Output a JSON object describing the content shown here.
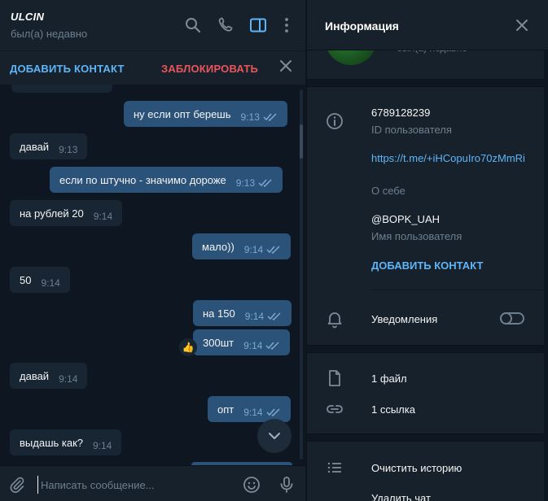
{
  "chat": {
    "name": "ULCIN",
    "status": "был(а) недавно",
    "actions": {
      "add_contact": "ДОБАВИТЬ КОНТАКТ",
      "block": "ЗАБЛОКИРОВАТЬ"
    },
    "messages": [
      {
        "dir": "out",
        "text": "ну если опт берешь",
        "time": "9:13",
        "read": true
      },
      {
        "dir": "in",
        "text": "давай",
        "time": "9:13"
      },
      {
        "dir": "out",
        "text": "если по штучно - значимо дороже",
        "time": "9:13",
        "read": true
      },
      {
        "dir": "in",
        "text": "на рублей 20",
        "time": "9:14"
      },
      {
        "dir": "out",
        "text": "мало))",
        "time": "9:14",
        "read": true
      },
      {
        "dir": "in",
        "text": "50",
        "time": "9:14"
      },
      {
        "dir": "out",
        "text": "на 150",
        "time": "9:14",
        "read": true
      },
      {
        "dir": "out",
        "text": "300шт",
        "time": "9:14",
        "read": true,
        "reaction": "👍"
      },
      {
        "dir": "in",
        "text": "давай",
        "time": "9:14"
      },
      {
        "dir": "out",
        "text": "опт",
        "time": "9:14",
        "read": true
      },
      {
        "dir": "in",
        "text": "выдашь как?",
        "time": "9:14"
      }
    ],
    "composer": {
      "placeholder": "Написать сообщение..."
    }
  },
  "info": {
    "title": "Информация",
    "status": "был(а) недавно",
    "user_id": "6789128239",
    "user_id_label": "ID пользователя",
    "bio": "https://t.me/+iHCopuIro70zMmRi",
    "bio_label": "О себе",
    "username": "@BOPK_UAH",
    "username_label": "Имя пользователя",
    "add_contact": "ДОБАВИТЬ КОНТАКТ",
    "notifications": "Уведомления",
    "notifications_on": false,
    "files": "1 файл",
    "links": "1 ссылка",
    "clear_history": "Очистить историю",
    "delete_chat": "Удалить чат"
  },
  "colors": {
    "background": "#0e1621",
    "panel": "#17212b",
    "bubble_in": "#182533",
    "bubble_out": "#2b5278",
    "accent": "#5eb5f7",
    "danger": "#e9555b"
  }
}
